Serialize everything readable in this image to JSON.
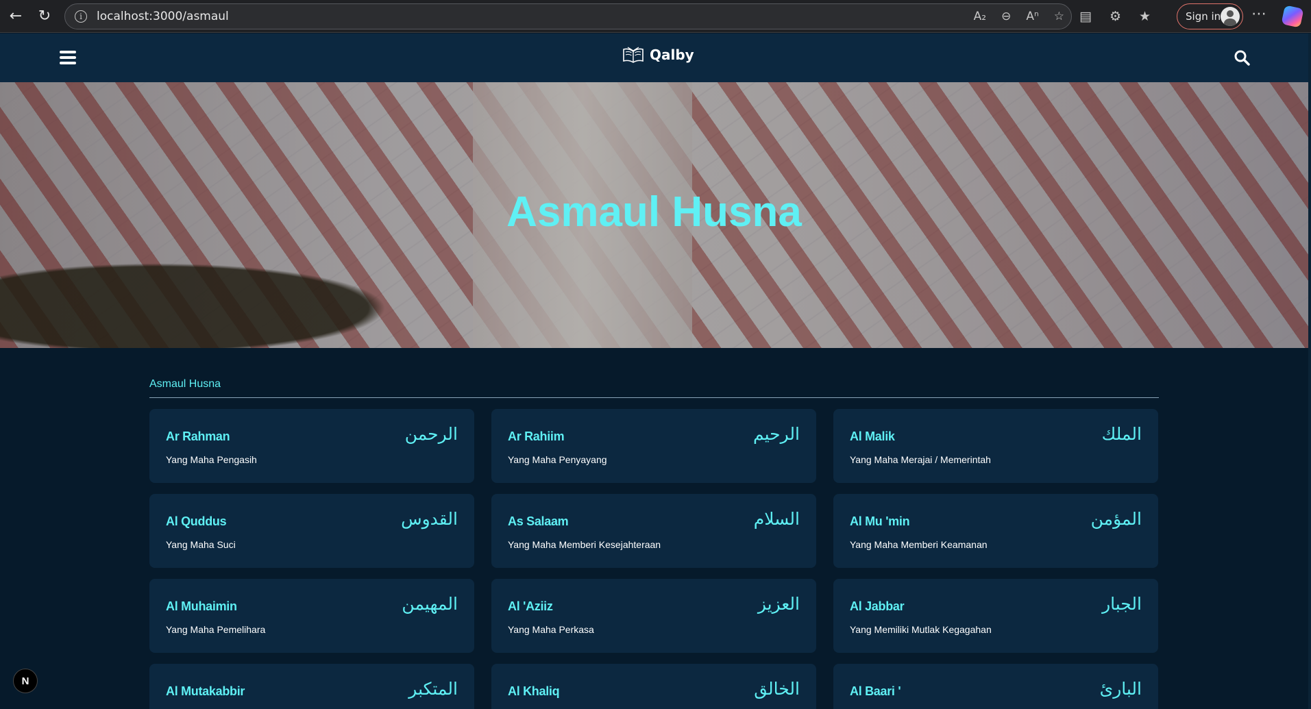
{
  "browser": {
    "url": "localhost:3000/asmaul",
    "sign_in_label": "Sign in"
  },
  "nav": {
    "brand": "Qalby"
  },
  "hero": {
    "title": "Asmaul Husna"
  },
  "section": {
    "label": "Asmaul Husna"
  },
  "names": [
    {
      "latin": "Ar Rahman",
      "arabic": "الرحمن",
      "meaning": "Yang Maha Pengasih"
    },
    {
      "latin": "Ar Rahiim",
      "arabic": "الرحيم",
      "meaning": "Yang Maha Penyayang"
    },
    {
      "latin": "Al Malik",
      "arabic": "الملك",
      "meaning": "Yang Maha Merajai / Memerintah"
    },
    {
      "latin": "Al Quddus",
      "arabic": "القدوس",
      "meaning": "Yang Maha Suci"
    },
    {
      "latin": "As Salaam",
      "arabic": "السلام",
      "meaning": "Yang Maha Memberi Kesejahteraan"
    },
    {
      "latin": "Al Mu 'min",
      "arabic": "المؤمن",
      "meaning": "Yang Maha Memberi Keamanan"
    },
    {
      "latin": "Al Muhaimin",
      "arabic": "المهيمن",
      "meaning": "Yang Maha Pemelihara"
    },
    {
      "latin": "Al 'Aziiz",
      "arabic": "العزيز",
      "meaning": "Yang Maha Perkasa"
    },
    {
      "latin": "Al Jabbar",
      "arabic": "الجبار",
      "meaning": "Yang Memiliki Mutlak Kegagahan"
    },
    {
      "latin": "Al Mutakabbir",
      "arabic": "المتكبر",
      "meaning": ""
    },
    {
      "latin": "Al Khaliq",
      "arabic": "الخالق",
      "meaning": ""
    },
    {
      "latin": "Al Baari '",
      "arabic": "البارئ",
      "meaning": ""
    }
  ],
  "dev_badge": "N",
  "colors": {
    "accent": "#5ff0f4",
    "page_bg": "#061a2b",
    "card_bg": "#0c2840"
  }
}
